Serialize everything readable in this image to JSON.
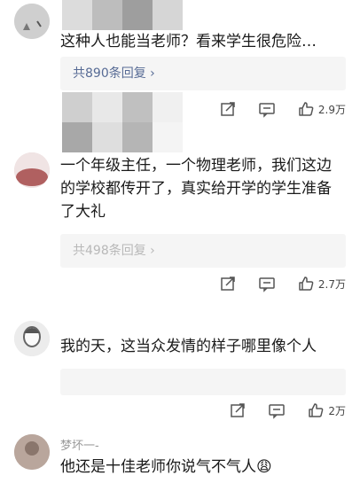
{
  "comments": [
    {
      "text": "这种人也能当老师？看来学生很危险…",
      "replies": "共890条回复 ›",
      "likes": "2.9万"
    },
    {
      "text": "一个年级主任，一个物理老师，我们这边的学校都传开了，真实给开学的学生准备了大礼",
      "replies": "共498条回复 ›",
      "likes": "2.7万"
    },
    {
      "text": "我的天，这当众发情的样子哪里像个人",
      "likes": "2万"
    },
    {
      "username": "梦坏一-",
      "text": "他还是十佳老师你说气不气人😩"
    }
  ],
  "icons": {
    "share": "share-icon",
    "comment": "comment-icon",
    "like": "thumbs-up-icon"
  },
  "colors": {
    "reply_link": "#576b95",
    "background": "#ffffff",
    "panel": "#f5f5f5"
  }
}
